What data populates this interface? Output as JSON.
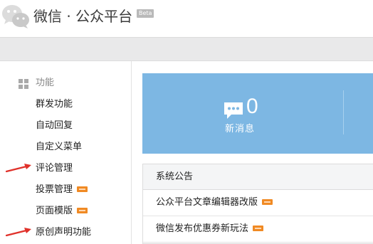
{
  "header": {
    "logo_icon": "wechat-logo-icon",
    "title": "微信 · 公众平台",
    "beta": "Beta"
  },
  "sidebar": {
    "section_icon": "grid-icon",
    "section_label": "功能",
    "items": [
      {
        "label": "群发功能",
        "new": false
      },
      {
        "label": "自动回复",
        "new": false
      },
      {
        "label": "自定义菜单",
        "new": false
      },
      {
        "label": "评论管理",
        "new": false
      },
      {
        "label": "投票管理",
        "new": true
      },
      {
        "label": "页面模版",
        "new": true
      },
      {
        "label": "原创声明功能",
        "new": false
      }
    ]
  },
  "stats": {
    "icon": "chat-bubble-icon",
    "count": "0",
    "label": "新消息"
  },
  "notices": {
    "title": "系统公告",
    "items": [
      {
        "label": "公众平台文章编辑器改版",
        "new": true
      },
      {
        "label": "微信发布优惠券新玩法",
        "new": true
      }
    ]
  },
  "colors": {
    "accent_panel": "#7db7e3",
    "new_badge": "#f08a24",
    "annotation_arrow": "#e0312a"
  }
}
